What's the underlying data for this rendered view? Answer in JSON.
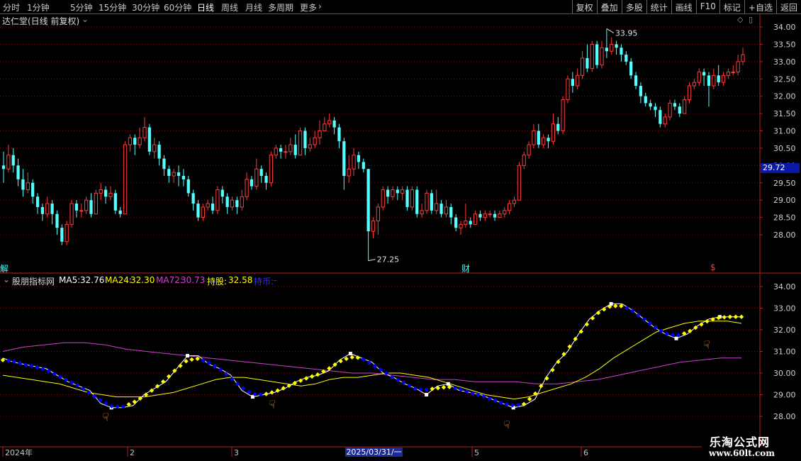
{
  "toolbar": {
    "left_items": [
      "分时",
      "1分钟",
      "5分钟",
      "15分钟",
      "30分钟",
      "60分钟",
      "日线",
      "周线",
      "月线",
      "多周期",
      "更多"
    ],
    "active": "日线",
    "right_items": [
      "复权",
      "叠加",
      "多股",
      "统计",
      "画线",
      "F10",
      "标记",
      "+自选",
      "返回"
    ]
  },
  "main_panel": {
    "title": "达仁堂(日线 前复权)",
    "y_ticks": [
      "34.00",
      "33.50",
      "33.00",
      "32.50",
      "32.00",
      "31.50",
      "31.00",
      "30.50",
      "30.00",
      "29.50",
      "29.00",
      "28.50",
      "28.00"
    ],
    "high_label": "33.95",
    "low_label": "27.25",
    "current_price": "29.72",
    "markers": [
      "解",
      "财",
      "$"
    ]
  },
  "sub_panel": {
    "name": "股朋指标网",
    "ma5_label": "MA5:",
    "ma5": "32.76",
    "ma24_label": "MA24:",
    "ma24": "32.30",
    "ma72_label": "MA72:",
    "ma72": "30.73",
    "hold_label": "持股:",
    "hold": "32.58",
    "cash_label": "持币:",
    "cash": "-",
    "y_ticks": [
      "34.00",
      "33.00",
      "32.00",
      "31.00",
      "30.00",
      "29.00",
      "28.00"
    ]
  },
  "x_axis": {
    "labels": [
      "2024年",
      "2",
      "3",
      "4",
      "5",
      "6"
    ],
    "cursor_date": "2025/03/31/一"
  },
  "watermark": {
    "line1": "乐淘公式网",
    "line2": "www.60lt.com"
  },
  "colors": {
    "up": "#ff3c3c",
    "down": "#54ffff",
    "ma5": "#ffffff",
    "ma24": "#ffff00",
    "ma72": "#d040d0",
    "hold": "#ffff00",
    "cash": "#0000ff",
    "grid": "#7a1010"
  },
  "chart_data": {
    "type": "candlestick",
    "ylim": [
      27.2,
      34.2
    ],
    "candles": [
      [
        30.0,
        29.9,
        30.4,
        29.5
      ],
      [
        29.9,
        30.3,
        30.6,
        29.8
      ],
      [
        30.3,
        30.0,
        30.5,
        29.8
      ],
      [
        30.0,
        29.6,
        30.2,
        29.4
      ],
      [
        29.6,
        29.3,
        29.9,
        29.1
      ],
      [
        29.3,
        29.5,
        29.8,
        29.2
      ],
      [
        29.5,
        29.1,
        29.6,
        28.9
      ],
      [
        29.1,
        28.8,
        29.2,
        28.6
      ],
      [
        28.8,
        28.6,
        28.9,
        28.4
      ],
      [
        28.6,
        28.9,
        29.1,
        28.5
      ],
      [
        28.9,
        28.6,
        29.0,
        28.3
      ],
      [
        28.6,
        28.2,
        28.7,
        28.0
      ],
      [
        28.2,
        27.8,
        28.3,
        27.7
      ],
      [
        27.8,
        28.3,
        28.4,
        27.7
      ],
      [
        28.3,
        28.9,
        29.0,
        28.2
      ],
      [
        28.9,
        28.7,
        29.0,
        28.5
      ],
      [
        28.7,
        28.7,
        28.9,
        28.5
      ],
      [
        28.7,
        29.0,
        29.1,
        28.6
      ],
      [
        29.0,
        28.6,
        29.2,
        28.5
      ],
      [
        28.6,
        29.2,
        29.3,
        28.6
      ],
      [
        29.2,
        29.3,
        29.5,
        29.0
      ],
      [
        29.3,
        29.1,
        29.4,
        28.9
      ],
      [
        29.1,
        29.2,
        29.4,
        29.0
      ],
      [
        29.2,
        28.7,
        29.3,
        28.6
      ],
      [
        28.7,
        28.6,
        28.8,
        28.5
      ],
      [
        28.6,
        30.6,
        30.7,
        28.6
      ],
      [
        30.6,
        30.8,
        30.9,
        30.4
      ],
      [
        30.8,
        30.6,
        30.9,
        30.3
      ],
      [
        30.6,
        30.8,
        31.1,
        30.5
      ],
      [
        30.8,
        31.1,
        31.4,
        30.7
      ],
      [
        31.1,
        30.4,
        31.2,
        30.3
      ],
      [
        30.4,
        30.6,
        30.8,
        30.2
      ],
      [
        30.6,
        30.2,
        30.7,
        30.0
      ],
      [
        30.2,
        29.9,
        30.3,
        29.7
      ],
      [
        29.9,
        29.7,
        30.0,
        29.5
      ],
      [
        29.7,
        29.8,
        29.9,
        29.5
      ],
      [
        29.8,
        29.7,
        30.0,
        29.4
      ],
      [
        29.7,
        29.6,
        29.9,
        29.4
      ],
      [
        29.6,
        29.2,
        29.7,
        29.1
      ],
      [
        29.2,
        28.9,
        29.3,
        28.7
      ],
      [
        28.9,
        28.5,
        29.0,
        28.4
      ],
      [
        28.5,
        28.8,
        28.9,
        28.4
      ],
      [
        28.8,
        28.9,
        29.0,
        28.7
      ],
      [
        28.9,
        28.7,
        29.1,
        28.6
      ],
      [
        28.7,
        29.3,
        29.4,
        28.6
      ],
      [
        29.3,
        29.1,
        29.4,
        28.9
      ],
      [
        29.1,
        28.8,
        29.2,
        28.6
      ],
      [
        28.8,
        29.0,
        29.1,
        28.7
      ],
      [
        29.0,
        28.8,
        29.1,
        28.6
      ],
      [
        28.8,
        29.1,
        29.3,
        28.7
      ],
      [
        29.1,
        29.6,
        29.8,
        29.0
      ],
      [
        29.6,
        29.4,
        29.7,
        29.3
      ],
      [
        29.4,
        29.9,
        30.2,
        29.3
      ],
      [
        29.9,
        29.7,
        30.0,
        29.5
      ],
      [
        29.7,
        29.5,
        29.8,
        29.3
      ],
      [
        29.5,
        30.3,
        30.4,
        29.4
      ],
      [
        30.3,
        30.5,
        30.6,
        30.2
      ],
      [
        30.5,
        30.4,
        30.6,
        30.2
      ],
      [
        30.4,
        30.4,
        30.6,
        30.2
      ],
      [
        30.4,
        30.6,
        30.8,
        30.3
      ],
      [
        30.6,
        30.3,
        30.9,
        30.2
      ],
      [
        30.3,
        31.0,
        31.1,
        30.3
      ],
      [
        31.0,
        30.5,
        31.1,
        30.3
      ],
      [
        30.5,
        30.6,
        30.8,
        30.4
      ],
      [
        30.6,
        30.8,
        31.0,
        30.5
      ],
      [
        30.8,
        31.0,
        31.3,
        30.6
      ],
      [
        31.0,
        31.2,
        31.4,
        31.0
      ],
      [
        31.2,
        31.3,
        31.5,
        31.1
      ],
      [
        31.3,
        31.1,
        31.4,
        30.9
      ],
      [
        31.1,
        30.7,
        31.2,
        30.5
      ],
      [
        30.7,
        29.7,
        30.8,
        29.3
      ],
      [
        29.7,
        29.9,
        30.3,
        29.5
      ],
      [
        29.9,
        30.3,
        30.5,
        29.7
      ],
      [
        30.3,
        30.1,
        30.4,
        29.9
      ],
      [
        30.1,
        29.9,
        30.2,
        29.8
      ],
      [
        29.9,
        28.1,
        29.9,
        27.25
      ],
      [
        28.1,
        28.4,
        28.5,
        27.9
      ],
      [
        28.4,
        28.8,
        28.9,
        28.0
      ],
      [
        28.8,
        29.3,
        29.4,
        28.7
      ],
      [
        29.3,
        29.1,
        29.4,
        28.9
      ],
      [
        29.1,
        29.3,
        29.4,
        29.0
      ],
      [
        29.3,
        29.2,
        29.4,
        29.0
      ],
      [
        29.2,
        29.3,
        29.4,
        29.0
      ],
      [
        29.3,
        28.8,
        29.4,
        28.7
      ],
      [
        28.8,
        29.3,
        29.4,
        28.7
      ],
      [
        29.3,
        28.6,
        29.4,
        28.5
      ],
      [
        28.6,
        28.7,
        28.9,
        28.5
      ],
      [
        28.7,
        29.2,
        29.3,
        28.6
      ],
      [
        29.2,
        28.7,
        29.3,
        28.6
      ],
      [
        28.7,
        28.9,
        29.3,
        28.6
      ],
      [
        28.9,
        28.6,
        29.0,
        28.5
      ],
      [
        28.6,
        28.8,
        29.0,
        28.5
      ],
      [
        28.8,
        28.5,
        28.9,
        28.3
      ],
      [
        28.5,
        28.2,
        28.6,
        28.1
      ],
      [
        28.2,
        28.3,
        28.4,
        28.0
      ],
      [
        28.3,
        28.4,
        28.9,
        28.2
      ],
      [
        28.4,
        28.3,
        28.5,
        28.2
      ],
      [
        28.3,
        28.6,
        28.7,
        28.3
      ],
      [
        28.6,
        28.5,
        28.7,
        28.4
      ],
      [
        28.5,
        28.6,
        28.7,
        28.4
      ],
      [
        28.6,
        28.6,
        28.7,
        28.5
      ],
      [
        28.6,
        28.5,
        28.7,
        28.4
      ],
      [
        28.5,
        28.6,
        28.7,
        28.5
      ],
      [
        28.6,
        28.7,
        28.8,
        28.5
      ],
      [
        28.7,
        28.9,
        29.0,
        28.6
      ],
      [
        28.9,
        29.0,
        29.1,
        28.8
      ],
      [
        29.0,
        30.0,
        30.1,
        29.0
      ],
      [
        30.0,
        30.3,
        30.4,
        29.9
      ],
      [
        30.3,
        30.6,
        30.7,
        30.2
      ],
      [
        30.6,
        31.0,
        31.2,
        30.5
      ],
      [
        31.0,
        30.6,
        31.2,
        30.5
      ],
      [
        30.6,
        30.8,
        30.9,
        30.5
      ],
      [
        30.8,
        30.7,
        30.9,
        30.5
      ],
      [
        30.7,
        31.2,
        31.5,
        30.6
      ],
      [
        31.2,
        31.0,
        31.4,
        30.9
      ],
      [
        31.0,
        31.9,
        32.0,
        30.9
      ],
      [
        31.9,
        32.5,
        32.6,
        31.8
      ],
      [
        32.5,
        32.3,
        32.7,
        32.1
      ],
      [
        32.3,
        32.6,
        32.8,
        32.2
      ],
      [
        32.6,
        33.1,
        33.3,
        32.5
      ],
      [
        33.1,
        32.8,
        33.5,
        32.7
      ],
      [
        32.8,
        33.5,
        33.6,
        32.7
      ],
      [
        33.5,
        32.9,
        33.6,
        32.8
      ],
      [
        32.9,
        33.4,
        33.6,
        32.8
      ],
      [
        33.4,
        33.3,
        33.95,
        33.1
      ],
      [
        33.3,
        33.5,
        33.7,
        33.2
      ],
      [
        33.5,
        33.4,
        33.6,
        33.2
      ],
      [
        33.4,
        33.2,
        33.5,
        33.0
      ],
      [
        33.2,
        33.0,
        33.3,
        32.9
      ],
      [
        33.0,
        32.6,
        33.1,
        32.5
      ],
      [
        32.6,
        32.3,
        32.7,
        32.2
      ],
      [
        32.3,
        32.0,
        32.4,
        31.8
      ],
      [
        32.0,
        31.8,
        32.1,
        31.7
      ],
      [
        31.8,
        31.7,
        31.9,
        31.6
      ],
      [
        31.7,
        31.6,
        31.8,
        31.4
      ],
      [
        31.6,
        31.2,
        31.7,
        31.1
      ],
      [
        31.2,
        31.4,
        31.5,
        31.1
      ],
      [
        31.4,
        31.8,
        31.9,
        31.3
      ],
      [
        31.8,
        31.7,
        31.9,
        31.6
      ],
      [
        31.7,
        31.5,
        31.8,
        31.4
      ],
      [
        31.5,
        31.9,
        32.0,
        31.5
      ],
      [
        31.9,
        32.3,
        32.4,
        31.8
      ],
      [
        32.3,
        32.4,
        32.5,
        32.2
      ],
      [
        32.4,
        32.7,
        32.8,
        32.3
      ],
      [
        32.7,
        32.6,
        32.8,
        32.3
      ],
      [
        32.6,
        32.3,
        32.7,
        31.7
      ],
      [
        32.3,
        32.6,
        32.8,
        32.2
      ],
      [
        32.6,
        32.4,
        32.9,
        32.3
      ],
      [
        32.4,
        32.6,
        32.7,
        32.3
      ],
      [
        32.6,
        32.7,
        32.8,
        32.5
      ],
      [
        32.7,
        32.7,
        32.9,
        32.6
      ],
      [
        32.7,
        33.0,
        33.2,
        32.6
      ],
      [
        33.0,
        33.2,
        33.4,
        32.9
      ]
    ],
    "ma5": [
      30.7,
      30.5,
      30.4,
      30.3,
      30.2,
      29.9,
      29.6,
      29.4,
      29.2,
      28.6,
      28.4,
      28.4,
      28.5,
      29.0,
      29.3,
      29.6,
      30.2,
      30.8,
      30.8,
      30.4,
      30.2,
      29.9,
      29.2,
      28.9,
      29.0,
      29.1,
      29.3,
      29.6,
      29.8,
      29.9,
      30.1,
      30.6,
      30.9,
      30.7,
      30.5,
      30.0,
      29.8,
      29.5,
      29.3,
      29.0,
      29.4,
      29.5,
      29.2,
      29.1,
      29.0,
      28.8,
      28.6,
      28.4,
      28.5,
      28.8,
      29.8,
      30.5,
      31.0,
      31.8,
      32.5,
      32.9,
      33.2,
      33.2,
      32.9,
      32.5,
      32.1,
      31.8,
      31.6,
      31.8,
      32.2,
      32.5,
      32.6,
      32.6,
      32.6
    ],
    "ma24": [
      29.9,
      29.8,
      29.7,
      29.6,
      29.5,
      29.3,
      29.1,
      29.0,
      28.9,
      28.9,
      28.9,
      29.0,
      29.1,
      29.3,
      29.5,
      29.7,
      29.8,
      29.8,
      29.7,
      29.6,
      29.5,
      29.4,
      29.5,
      29.7,
      29.8,
      29.8,
      29.9,
      30.0,
      30.0,
      29.9,
      29.8,
      29.6,
      29.4,
      29.2,
      29.0,
      28.9,
      28.8,
      28.9,
      29.1,
      29.3,
      29.5,
      29.8,
      30.2,
      30.7,
      31.1,
      31.5,
      31.9,
      32.1,
      32.3,
      32.4,
      32.4,
      32.4,
      32.3
    ],
    "ma72": [
      31.0,
      31.2,
      31.3,
      31.4,
      31.4,
      31.3,
      31.1,
      31.0,
      30.9,
      30.8,
      30.7,
      30.6,
      30.5,
      30.4,
      30.3,
      30.2,
      30.1,
      30.0,
      30.0,
      29.9,
      29.8,
      29.7,
      29.7,
      29.6,
      29.6,
      29.6,
      29.5,
      29.5,
      29.6,
      29.7,
      29.9,
      30.1,
      30.3,
      30.5,
      30.6,
      30.7,
      30.7
    ]
  }
}
